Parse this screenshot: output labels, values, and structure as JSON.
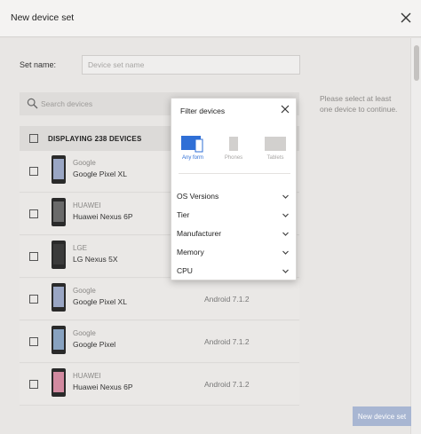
{
  "dialog": {
    "title": "New device set"
  },
  "set_name": {
    "label": "Set name:",
    "placeholder": "Device set name",
    "value": ""
  },
  "hint": "Please select at least one device to continue.",
  "search": {
    "placeholder": "Search devices"
  },
  "list_header": {
    "label": "DISPLAYING 238 DEVICES"
  },
  "devices": [
    {
      "maker": "Google",
      "model": "Google Pixel XL",
      "os": "",
      "screen_color": "#9aa6c4"
    },
    {
      "maker": "HUAWEI",
      "model": "Huawei Nexus 6P",
      "os": "",
      "screen_color": "#6a6a6a"
    },
    {
      "maker": "LGE",
      "model": "LG Nexus 5X",
      "os": "",
      "screen_color": "#3b3b3b"
    },
    {
      "maker": "Google",
      "model": "Google Pixel XL",
      "os": "Android 7.1.2",
      "screen_color": "#9aa6c4"
    },
    {
      "maker": "Google",
      "model": "Google Pixel",
      "os": "Android 7.1.2",
      "screen_color": "#88a2c0"
    },
    {
      "maker": "HUAWEI",
      "model": "Huawei Nexus 6P",
      "os": "Android 7.1.2",
      "screen_color": "#d28aa0"
    }
  ],
  "filter": {
    "title": "Filter devices",
    "forms": [
      {
        "label": "Any form",
        "active": true
      },
      {
        "label": "Phones",
        "active": false
      },
      {
        "label": "Tablets",
        "active": false
      }
    ],
    "sections": [
      "OS Versions",
      "Tier",
      "Manufacturer",
      "Memory",
      "CPU"
    ]
  },
  "footer": {
    "new_button_label": "New device set"
  },
  "colors": {
    "accent": "#2f6fd6",
    "disabled_button": "#a8b6d2"
  }
}
